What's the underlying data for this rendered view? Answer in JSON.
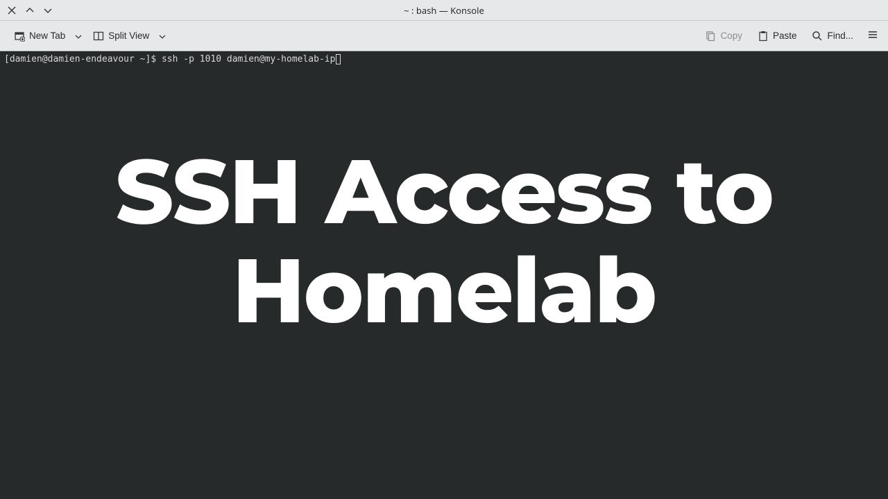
{
  "window": {
    "title": "~ : bash — Konsole"
  },
  "toolbar": {
    "new_tab": "New Tab",
    "split_view": "Split View",
    "copy": "Copy",
    "paste": "Paste",
    "find": "Find..."
  },
  "terminal": {
    "prompt": "[damien@damien-endeavour ~]$ ",
    "command": "ssh -p 1010 damien@my-homelab-ip"
  },
  "overlay": {
    "title": "SSH Access to Homelab"
  }
}
